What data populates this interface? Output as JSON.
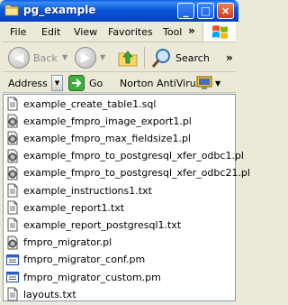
{
  "window": {
    "title": "pg_example",
    "minimize_glyph": "_",
    "maximize_glyph": "□",
    "close_glyph": "×"
  },
  "menu": {
    "items": [
      "File",
      "Edit",
      "View",
      "Favorites",
      "Tool"
    ],
    "overflow_glyph": "»"
  },
  "toolbar": {
    "back_label": "Back",
    "search_label": "Search",
    "overflow_glyph": "»"
  },
  "addressbar": {
    "address_label": "Address",
    "go_label": "Go",
    "antivirus_label": "Norton AntiVirus"
  },
  "files": [
    {
      "name": "example_create_table1.sql",
      "icon": "text-file-icon"
    },
    {
      "name": "example_fmpro_image_export1.pl",
      "icon": "perl-script-icon"
    },
    {
      "name": "example_fmpro_max_fieldsize1.pl",
      "icon": "perl-script-icon"
    },
    {
      "name": "example_fmpro_to_postgresql_xfer_odbc1.pl",
      "icon": "perl-script-icon"
    },
    {
      "name": "example_fmpro_to_postgresql_xfer_odbc21.pl",
      "icon": "perl-script-icon"
    },
    {
      "name": "example_instructions1.txt",
      "icon": "text-file-icon"
    },
    {
      "name": "example_report1.txt",
      "icon": "text-file-icon"
    },
    {
      "name": "example_report_postgresql1.txt",
      "icon": "text-file-icon"
    },
    {
      "name": "fmpro_migrator.pl",
      "icon": "perl-script-icon"
    },
    {
      "name": "fmpro_migrator_conf.pm",
      "icon": "pm-file-icon"
    },
    {
      "name": "fmpro_migrator_custom.pm",
      "icon": "pm-file-icon"
    },
    {
      "name": "layouts.txt",
      "icon": "text-file-icon"
    }
  ],
  "colors": {
    "titlebar": "#0a58d8",
    "chrome": "#ece9d8",
    "list_background": "#ffffff"
  }
}
